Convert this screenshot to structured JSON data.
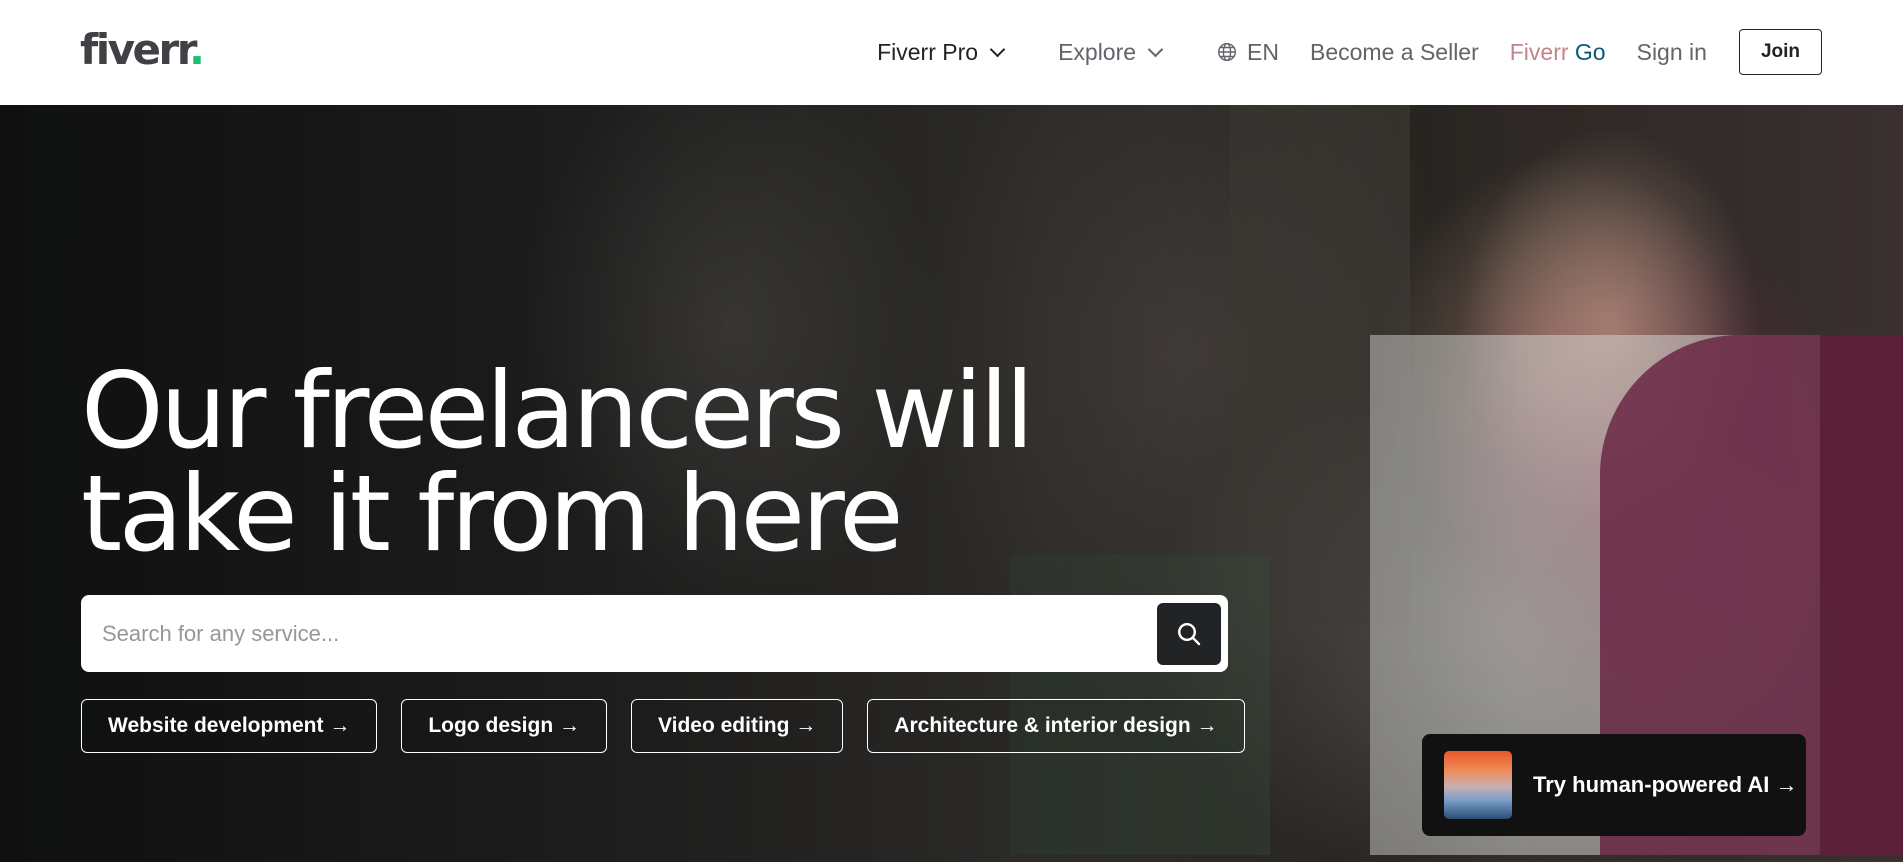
{
  "header": {
    "logo_text": "fiverr",
    "logo_dot": ".",
    "nav": {
      "fiverr_pro": "Fiverr Pro",
      "explore": "Explore",
      "language": "EN",
      "become_seller": "Become a Seller",
      "fiverr_go_a": "Fiverr",
      "fiverr_go_b": "Go",
      "sign_in": "Sign in",
      "join": "Join"
    }
  },
  "hero": {
    "headline_line1": "Our freelancers will",
    "headline_line2": "take it from here",
    "search": {
      "placeholder": "Search for any service...",
      "value": ""
    },
    "chips": [
      "Website development →",
      "Logo design →",
      "Video editing →",
      "Architecture & interior design →"
    ],
    "ai_card": {
      "label": "Try human-powered AI →"
    }
  },
  "icons": [
    "chevron-down-icon",
    "globe-icon",
    "search-icon"
  ],
  "colors": {
    "brand_green": "#1dbf73",
    "logo_text": "#404145",
    "nav_text": "#62646a",
    "fiverr_go_pink": "#c4838b",
    "fiverr_go_teal": "#0c5a72",
    "dark": "#222325"
  }
}
